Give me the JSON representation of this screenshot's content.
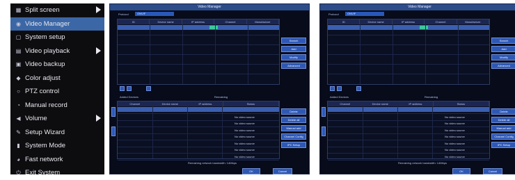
{
  "menu": {
    "items": [
      {
        "label": "Split screen",
        "icon": "grid-icon",
        "glyph": "▦",
        "selected": false,
        "submenu": true
      },
      {
        "label": "Video Manager",
        "icon": "camera-icon",
        "glyph": "◉",
        "selected": true,
        "submenu": false
      },
      {
        "label": "System setup",
        "icon": "settings-square-icon",
        "glyph": "▢",
        "selected": false,
        "submenu": false
      },
      {
        "label": "Video playback",
        "icon": "film-icon",
        "glyph": "▤",
        "selected": false,
        "submenu": true
      },
      {
        "label": "Video backup",
        "icon": "backup-icon",
        "glyph": "▣",
        "selected": false,
        "submenu": false
      },
      {
        "label": "Color adjust",
        "icon": "palette-icon",
        "glyph": "◆",
        "selected": false,
        "submenu": false
      },
      {
        "label": "PTZ control",
        "icon": "ptz-icon",
        "glyph": "○",
        "selected": false,
        "submenu": false
      },
      {
        "label": "Manual record",
        "icon": "record-icon",
        "glyph": "◔",
        "selected": false,
        "submenu": false
      },
      {
        "label": "Volume",
        "icon": "speaker-icon",
        "glyph": "◀",
        "selected": false,
        "submenu": true
      },
      {
        "label": "Setup Wizard",
        "icon": "wand-icon",
        "glyph": "✎",
        "selected": false,
        "submenu": false
      },
      {
        "label": "System Mode",
        "icon": "document-icon",
        "glyph": "▮",
        "selected": false,
        "submenu": false
      },
      {
        "label": "Fast network",
        "icon": "network-icon",
        "glyph": "◕",
        "selected": false,
        "submenu": false
      },
      {
        "label": "Exit System",
        "icon": "power-icon",
        "glyph": "⏻",
        "selected": false,
        "submenu": false
      }
    ]
  },
  "dialogs": [
    {
      "title": "Video Manager",
      "protocol_label": "Protocol",
      "protocol_value": "ONVIF",
      "search_headers": [
        "ID",
        "Device name",
        "IP address",
        "Channel",
        "Manufacture"
      ],
      "search_buttons": [
        "Search",
        "Add",
        "Modify",
        "Advanced"
      ],
      "added_label": "Added Devices",
      "remain_label": "Remaining",
      "added_headers": [
        "Channel",
        "Device name",
        "IP address",
        "Status"
      ],
      "row_status": "No video source",
      "added_buttons": [
        "Delete",
        "Delete all",
        "Manual add",
        "Channel Config",
        "IPC Setup"
      ],
      "bandwidth_text": "Remaining network bandwidth: 14Mbps",
      "ok_label": "OK",
      "cancel_label": "Cancel"
    },
    {
      "title": "Video Manager",
      "protocol_label": "Protocol",
      "protocol_value": "ONVIF",
      "search_headers": [
        "ID",
        "Device name",
        "IP address",
        "Channel",
        "Manufacture"
      ],
      "search_buttons": [
        "Search",
        "Add",
        "Modify",
        "Advanced"
      ],
      "added_label": "Added Devices",
      "remain_label": "Remaining",
      "added_headers": [
        "Channel",
        "Device name",
        "IP address",
        "Status"
      ],
      "row_status": "No video source",
      "added_buttons": [
        "Delete",
        "Delete all",
        "Manual add",
        "Channel Config",
        "IPC Setup"
      ],
      "bandwidth_text": "Remaining network bandwidth: 14Mbps",
      "ok_label": "OK",
      "cancel_label": "Cancel"
    }
  ],
  "colors": {
    "menu_bg": "#0d0d10",
    "menu_selected": "#3b67a6",
    "panel_bg": "#070b1a",
    "button": "#2e58b4",
    "highlight_row": "#3a5fb0",
    "status_cell": "#3cc7a0"
  }
}
